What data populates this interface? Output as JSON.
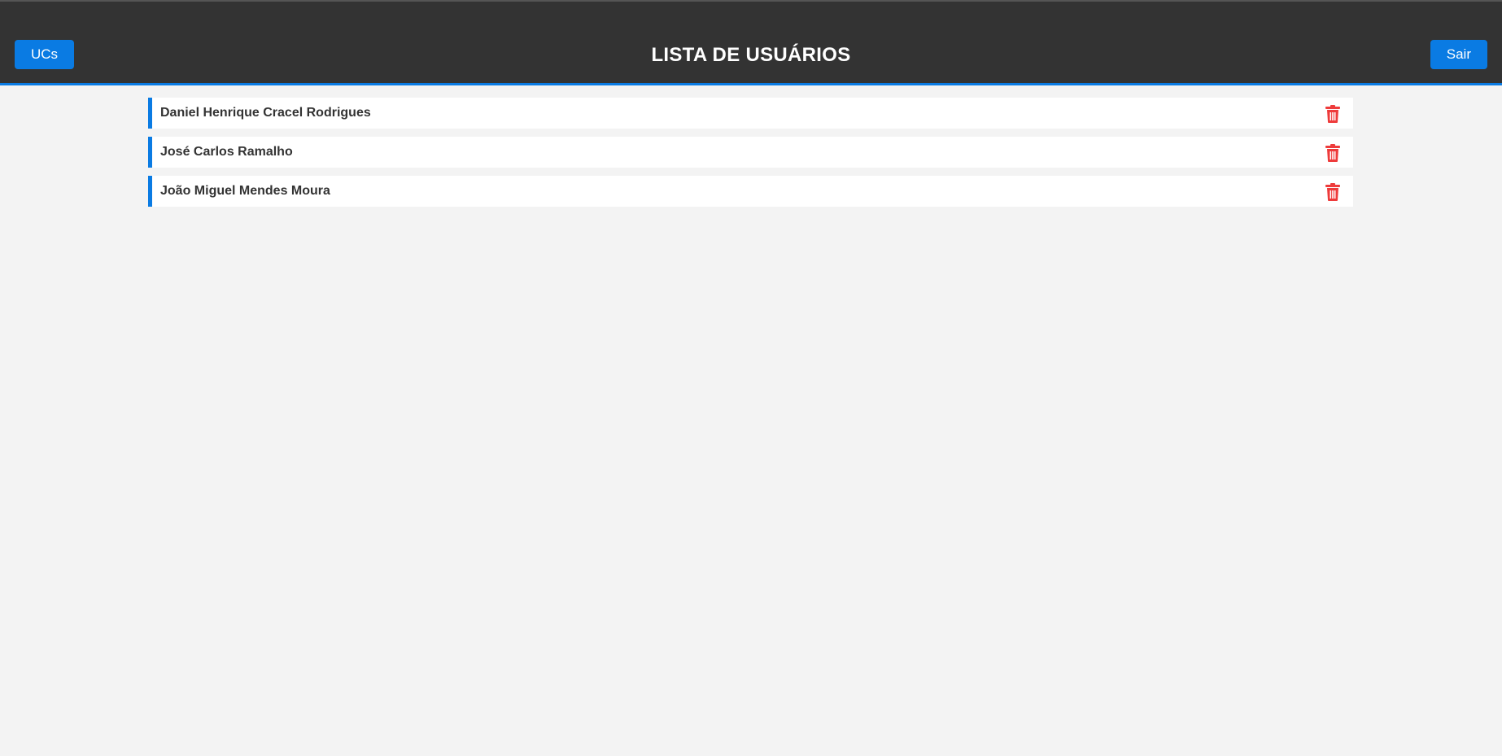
{
  "header": {
    "title": "LISTA DE USUÁRIOS",
    "left_button_label": "UCs",
    "right_button_label": "Sair"
  },
  "users": [
    {
      "name": "Daniel Henrique Cracel Rodrigues",
      "action_icon": "trash-icon"
    },
    {
      "name": "José Carlos Ramalho",
      "action_icon": "trash-icon"
    },
    {
      "name": "João Miguel Mendes Moura",
      "action_icon": "trash-icon"
    }
  ],
  "colors": {
    "header_bg": "#333333",
    "accent": "#0a7be3",
    "page_bg": "#f3f3f3",
    "delete": "#ee3b3b"
  }
}
